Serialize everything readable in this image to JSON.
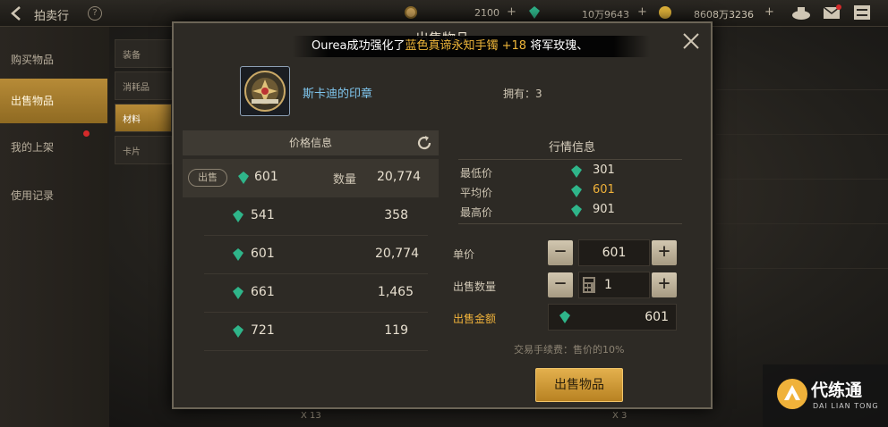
{
  "topbar": {
    "title": "拍卖行",
    "help": "?",
    "currencies": [
      {
        "value": "2100",
        "icon": "moon-coin-icon"
      },
      {
        "value": "10万9643",
        "icon": "gem-icon"
      },
      {
        "value": "8608万3236",
        "icon": "gold-coin-icon"
      }
    ],
    "plus": "+"
  },
  "sidebar": {
    "items": [
      {
        "label": "购买物品"
      },
      {
        "label": "出售物品"
      },
      {
        "label": "我的上架"
      },
      {
        "label": "使用记录"
      }
    ]
  },
  "subtabs": [
    "装备",
    "消耗品",
    "材料",
    "卡片"
  ],
  "background": {
    "bottom_counts": [
      "X 13",
      "X 3"
    ]
  },
  "dialog": {
    "title": "出售物品",
    "ticker": {
      "part1": "Ourea成功强化了",
      "part2": "蓝色真谛永知手镯 +18",
      "part3": "将军玫瑰、"
    },
    "item": {
      "name": "斯卡迪的印章",
      "owned": "拥有：3"
    },
    "price_panel": {
      "header": "价格信息",
      "sell_label": "出售",
      "quantity_label": "数量",
      "rows": [
        {
          "price": "601",
          "qty": "20,774"
        },
        {
          "price": "541",
          "qty": "358"
        },
        {
          "price": "601",
          "qty": "20,774"
        },
        {
          "price": "661",
          "qty": "1,465"
        },
        {
          "price": "721",
          "qty": "119"
        }
      ]
    },
    "market": {
      "header": "行情信息",
      "rows": [
        {
          "label": "最低价",
          "value": "301"
        },
        {
          "label": "平均价",
          "value": "601"
        },
        {
          "label": "最高价",
          "value": "901"
        }
      ]
    },
    "form": {
      "unit_price_label": "单价",
      "unit_price": "601",
      "quantity_label": "出售数量",
      "quantity": "1",
      "total_label": "出售金额",
      "total": "601",
      "minus": "−",
      "plus": "+"
    },
    "fee_text": "交易手续费：售价的10%",
    "sell_button": "出售物品"
  },
  "watermark": {
    "text": "代练通",
    "sub": "DAI LIAN TONG"
  },
  "colors": {
    "accent_gold": "#f0b23a",
    "item_blue": "#7fc6ee",
    "gem_green": "#2fb58a"
  }
}
